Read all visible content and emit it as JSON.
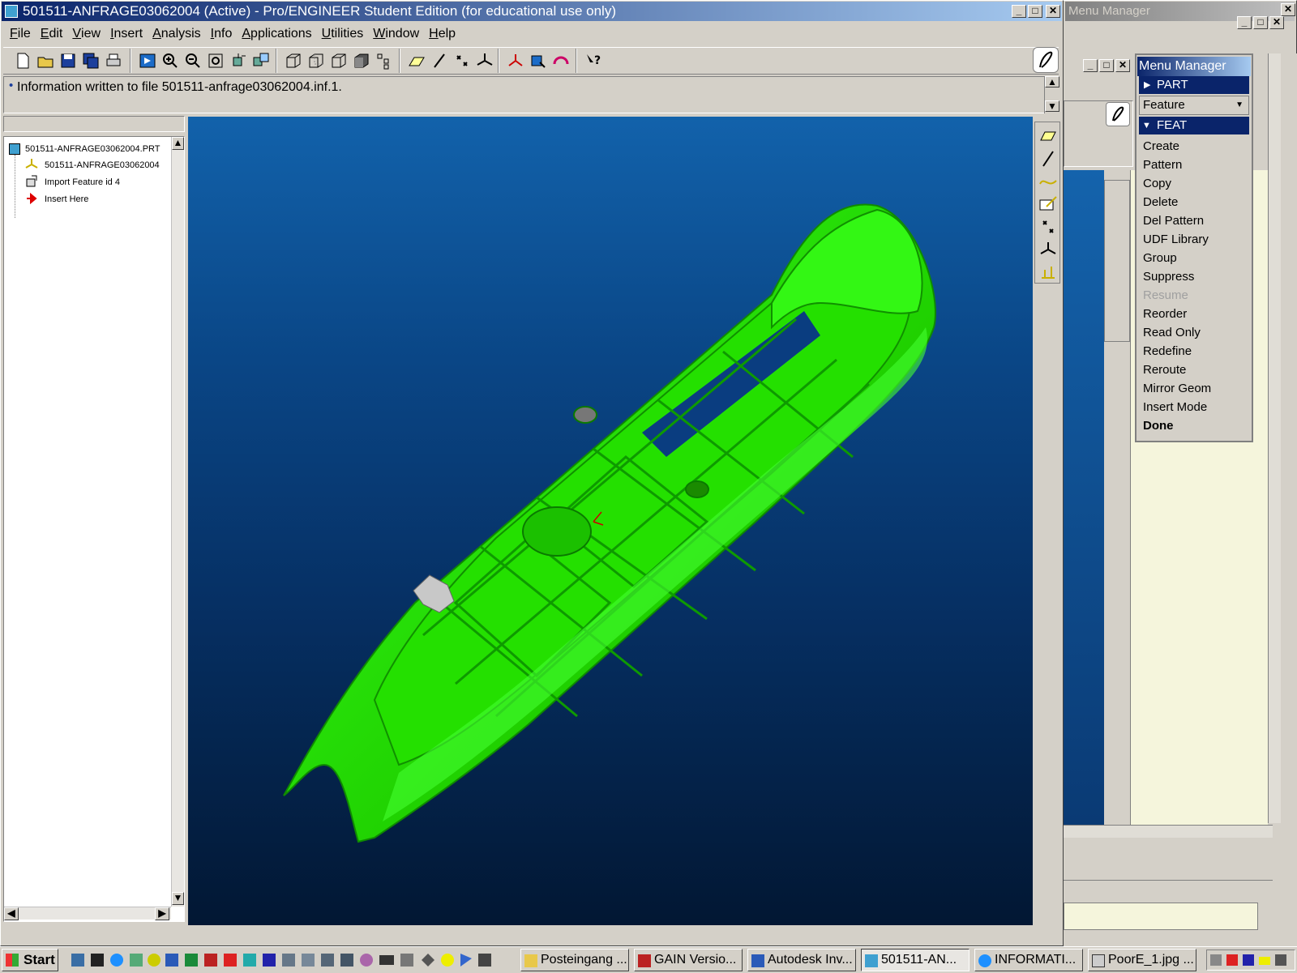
{
  "main_window": {
    "title": "501511-ANFRAGE03062004 (Active) - Pro/ENGINEER Student Edition (for educational use only)",
    "menu": [
      {
        "label": "File",
        "key": "F",
        "rest": "ile"
      },
      {
        "label": "Edit",
        "key": "E",
        "rest": "dit"
      },
      {
        "label": "View",
        "key": "V",
        "rest": "iew"
      },
      {
        "label": "Insert",
        "key": "I",
        "rest": "nsert"
      },
      {
        "label": "Analysis",
        "key": "A",
        "rest": "nalysis"
      },
      {
        "label": "Info",
        "key": "I",
        "rest": "nfo"
      },
      {
        "label": "Applications",
        "key": "A",
        "rest": "pplications"
      },
      {
        "label": "Utilities",
        "key": "U",
        "rest": "tilities"
      },
      {
        "label": "Window",
        "key": "W",
        "rest": "indow"
      },
      {
        "label": "Help",
        "key": "H",
        "rest": "elp"
      }
    ],
    "message": "Information written to file 501511-anfrage03062004.inf.1."
  },
  "model_tree": {
    "items": [
      {
        "label": "501511-ANFRAGE03062004.PRT",
        "icon": "part-icon"
      },
      {
        "label": "501511-ANFRAGE03062004",
        "icon": "csys-icon"
      },
      {
        "label": "Import Feature id 4",
        "icon": "import-feature-icon"
      },
      {
        "label": "Insert Here",
        "icon": "insert-arrow-icon"
      }
    ]
  },
  "secondary_window": {
    "title": "Menu Manager"
  },
  "menu_manager": {
    "title": "Menu Manager",
    "part_header": "PART",
    "dropdown_value": "Feature",
    "feat_header": "FEAT",
    "items": [
      {
        "label": "Create",
        "enabled": true
      },
      {
        "label": "Pattern",
        "enabled": true
      },
      {
        "label": "Copy",
        "enabled": true
      },
      {
        "label": "Delete",
        "enabled": true
      },
      {
        "label": "Del Pattern",
        "enabled": true
      },
      {
        "label": "UDF Library",
        "enabled": true
      },
      {
        "label": "Group",
        "enabled": true
      },
      {
        "label": "Suppress",
        "enabled": true
      },
      {
        "label": "Resume",
        "enabled": false
      },
      {
        "label": "Reorder",
        "enabled": true
      },
      {
        "label": "Read Only",
        "enabled": true
      },
      {
        "label": "Redefine",
        "enabled": true
      },
      {
        "label": "Reroute",
        "enabled": true
      },
      {
        "label": "Mirror Geom",
        "enabled": true
      },
      {
        "label": "Insert Mode",
        "enabled": true
      },
      {
        "label": "Done",
        "enabled": true,
        "bold": true
      }
    ]
  },
  "taskbar": {
    "start_label": "Start",
    "tasks": [
      {
        "label": "Posteingang ...",
        "icon": "outlook-icon"
      },
      {
        "label": "GAIN Versio...",
        "icon": "gain-icon"
      },
      {
        "label": "Autodesk Inv...",
        "icon": "autodesk-icon"
      },
      {
        "label": "501511-AN...",
        "icon": "proe-icon",
        "active": true
      },
      {
        "label": "INFORMATI...",
        "icon": "browser-icon"
      },
      {
        "label": "PoorE_1.jpg ...",
        "icon": "image-icon"
      }
    ]
  },
  "colors": {
    "title_active": "#0a246a",
    "viewport_top": "#0f5fa8",
    "viewport_bottom": "#02152f",
    "model_green": "#22e000",
    "menu_header": "#0a246a"
  }
}
